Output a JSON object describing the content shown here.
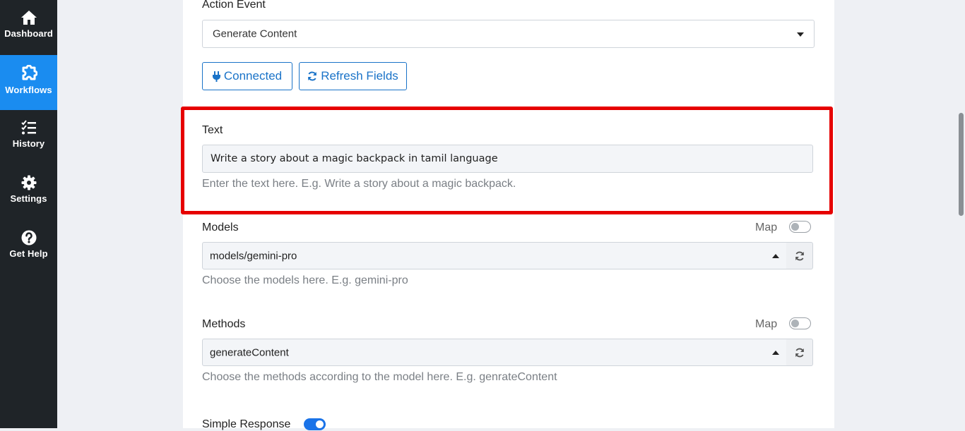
{
  "sidebar": {
    "items": [
      {
        "label": "Dashboard",
        "icon": "home-icon",
        "active": false
      },
      {
        "label": "Workflows",
        "icon": "puzzle-icon",
        "active": true
      },
      {
        "label": "History",
        "icon": "list-check-icon",
        "active": false
      },
      {
        "label": "Settings",
        "icon": "gear-icon",
        "active": false
      },
      {
        "label": "Get Help",
        "icon": "question-circle-icon",
        "active": false
      }
    ]
  },
  "action_event": {
    "label": "Action Event",
    "value": "Generate Content"
  },
  "buttons": {
    "connected": "Connected",
    "refresh_fields": "Refresh Fields"
  },
  "text_field": {
    "label": "Text",
    "value": "Write a story about a magic backpack in tamil language",
    "helper": "Enter the text here. E.g. Write a story about a magic backpack."
  },
  "models": {
    "label": "Models",
    "map_label": "Map",
    "value": "models/gemini-pro",
    "helper": "Choose the models here. E.g. gemini-pro"
  },
  "methods": {
    "label": "Methods",
    "map_label": "Map",
    "value": "generateContent",
    "helper": "Choose the methods according to the model here. E.g. genrateContent"
  },
  "simple_response": {
    "label": "Simple Response",
    "enabled": true
  },
  "colors": {
    "sidebar_bg": "#1f2428",
    "active_nav": "#1a8cf0",
    "accent": "#1a73c8",
    "highlight": "#e60000"
  }
}
